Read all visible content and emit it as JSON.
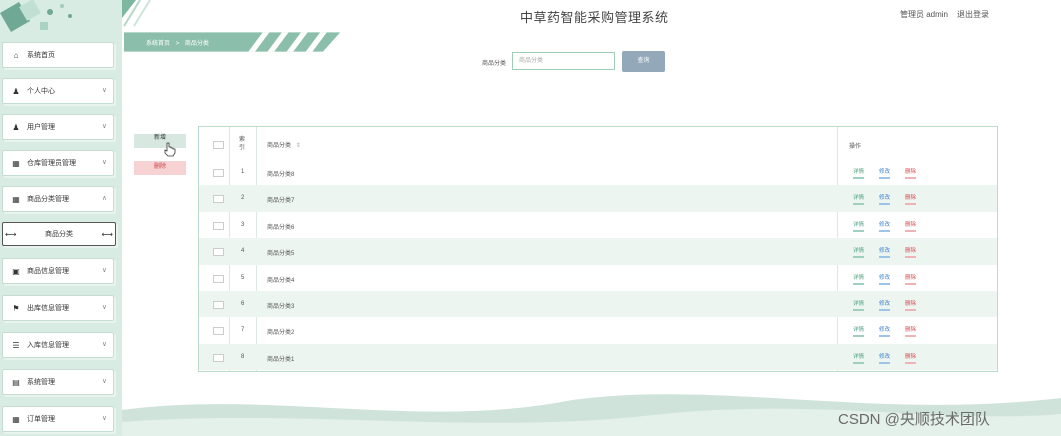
{
  "header": {
    "title": "中草药智能采购管理系统",
    "user": "管理员 admin",
    "logout": "退出登录"
  },
  "breadcrumb": {
    "home": "系统首页",
    "sep": ">",
    "current": "商品分类"
  },
  "sidebar": {
    "items": [
      {
        "label": "系统首页",
        "icon": "home-icon",
        "glyph": "⌂",
        "chevron": ""
      },
      {
        "label": "个人中心",
        "icon": "person-icon",
        "glyph": "♟",
        "chevron": "∨"
      },
      {
        "label": "用户管理",
        "icon": "person-icon",
        "glyph": "♟",
        "chevron": "∨"
      },
      {
        "label": "仓库管理员管理",
        "icon": "grid-icon",
        "glyph": "▦",
        "chevron": "∨"
      },
      {
        "label": "商品分类管理",
        "icon": "grid-icon",
        "glyph": "▦",
        "chevron": "∧"
      },
      {
        "label": "商品信息管理",
        "icon": "doc-icon",
        "glyph": "▣",
        "chevron": "∨"
      },
      {
        "label": "出库信息管理",
        "icon": "flag-icon",
        "glyph": "⚑",
        "chevron": "∨"
      },
      {
        "label": "入库信息管理",
        "icon": "list-icon",
        "glyph": "☰",
        "chevron": "∨"
      },
      {
        "label": "系统管理",
        "icon": "printer-icon",
        "glyph": "▤",
        "chevron": "∨"
      },
      {
        "label": "订单管理",
        "icon": "grid-icon",
        "glyph": "▦",
        "chevron": "∨"
      }
    ],
    "sub_item": "商品分类",
    "sub_arrow_left": "⟷",
    "sub_arrow_right": "⟷"
  },
  "search": {
    "label": "商品分类",
    "placeholder": "商品分类",
    "button": "查询"
  },
  "actions": {
    "add": "新增",
    "delete": "删除"
  },
  "table": {
    "headers": {
      "index": "索引",
      "category": "商品分类",
      "sort_icon": "⇕",
      "ops": "操作"
    },
    "rows": [
      {
        "index": "1",
        "category": "商品分类8"
      },
      {
        "index": "2",
        "category": "商品分类7"
      },
      {
        "index": "3",
        "category": "商品分类6"
      },
      {
        "index": "4",
        "category": "商品分类5"
      },
      {
        "index": "5",
        "category": "商品分类4"
      },
      {
        "index": "6",
        "category": "商品分类3"
      },
      {
        "index": "7",
        "category": "商品分类2"
      },
      {
        "index": "8",
        "category": "商品分类1"
      }
    ],
    "row_actions": {
      "detail": "详情",
      "edit": "修改",
      "delete": "删除"
    }
  },
  "watermark": "CSDN @央顺技术团队",
  "colors": {
    "sidebar_bg": "#d9ece4",
    "accent": "#6fa894",
    "search_btn": "#93a9b9",
    "delete": "#d24c4c"
  }
}
